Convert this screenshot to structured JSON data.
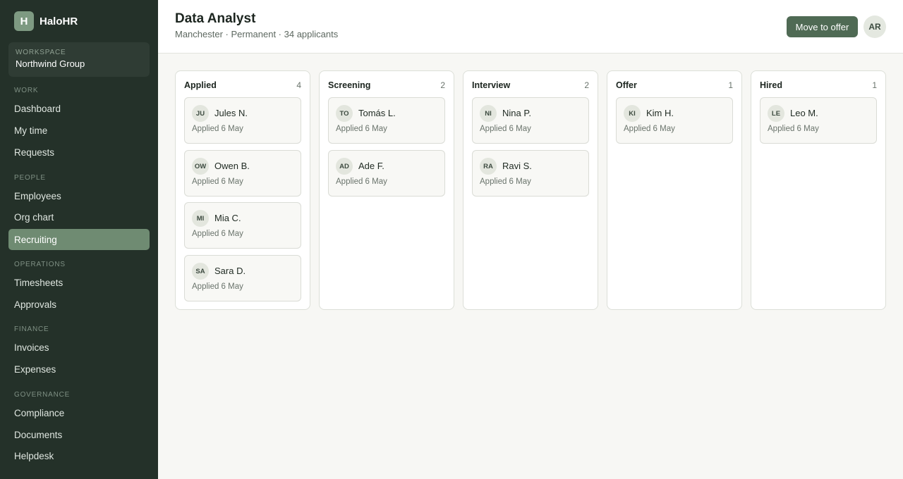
{
  "app": {
    "brand_mark": "H",
    "brand_name": "HaloHR"
  },
  "workspace": {
    "label": "WORKSPACE",
    "name": "Northwind Group"
  },
  "sidebar": {
    "sections": [
      {
        "label": "WORK",
        "items": [
          {
            "label": "Dashboard"
          },
          {
            "label": "My time"
          },
          {
            "label": "Requests"
          }
        ]
      },
      {
        "label": "PEOPLE",
        "items": [
          {
            "label": "Employees"
          },
          {
            "label": "Org chart"
          },
          {
            "label": "Recruiting",
            "active": true
          }
        ]
      },
      {
        "label": "OPERATIONS",
        "items": [
          {
            "label": "Timesheets"
          },
          {
            "label": "Approvals"
          }
        ]
      },
      {
        "label": "FINANCE",
        "items": [
          {
            "label": "Invoices"
          },
          {
            "label": "Expenses"
          }
        ]
      },
      {
        "label": "GOVERNANCE",
        "items": [
          {
            "label": "Compliance"
          },
          {
            "label": "Documents"
          },
          {
            "label": "Helpdesk"
          }
        ]
      }
    ]
  },
  "header": {
    "title": "Data Analyst",
    "subtitle": "Manchester · Permanent · 34 applicants",
    "action_label": "Move to offer",
    "user_initials": "AR"
  },
  "board": {
    "columns": [
      {
        "title": "Applied",
        "count": "4",
        "cards": [
          {
            "initials": "JU",
            "name": "Jules N.",
            "meta": "Applied 6 May"
          },
          {
            "initials": "OW",
            "name": "Owen B.",
            "meta": "Applied 6 May"
          },
          {
            "initials": "MI",
            "name": "Mia C.",
            "meta": "Applied 6 May"
          },
          {
            "initials": "SA",
            "name": "Sara D.",
            "meta": "Applied 6 May"
          }
        ]
      },
      {
        "title": "Screening",
        "count": "2",
        "cards": [
          {
            "initials": "TO",
            "name": "Tomás L.",
            "meta": "Applied 6 May"
          },
          {
            "initials": "AD",
            "name": "Ade F.",
            "meta": "Applied 6 May"
          }
        ]
      },
      {
        "title": "Interview",
        "count": "2",
        "cards": [
          {
            "initials": "NI",
            "name": "Nina P.",
            "meta": "Applied 6 May"
          },
          {
            "initials": "RA",
            "name": "Ravi S.",
            "meta": "Applied 6 May"
          }
        ]
      },
      {
        "title": "Offer",
        "count": "1",
        "cards": [
          {
            "initials": "KI",
            "name": "Kim H.",
            "meta": "Applied 6 May"
          }
        ]
      },
      {
        "title": "Hired",
        "count": "1",
        "cards": [
          {
            "initials": "LE",
            "name": "Leo M.",
            "meta": "Applied 6 May"
          }
        ]
      }
    ]
  }
}
